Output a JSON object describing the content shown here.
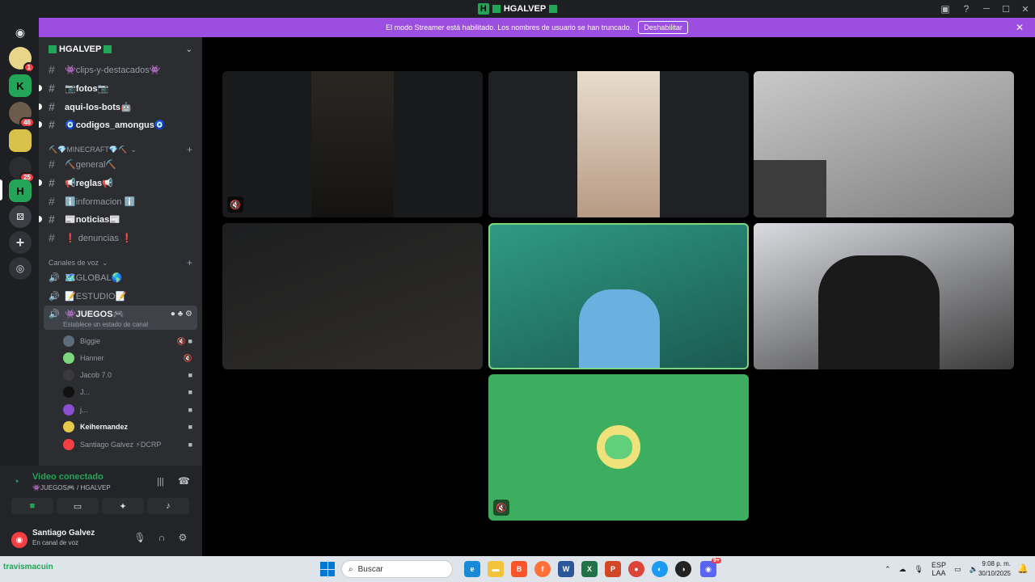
{
  "titlebar": {
    "title": "HGALVEP"
  },
  "banner": {
    "message": "El modo Streamer está habilitado. Los nombres de usuario se han truncado.",
    "button": "Deshabilitar"
  },
  "rail": {
    "badges": [
      "1",
      "46",
      "25"
    ]
  },
  "guild": {
    "name": "HGALVEP"
  },
  "channels": [
    {
      "name": "👾clips-y-destacados👾",
      "bold": false
    },
    {
      "name": "📷fotos📷",
      "bold": true
    },
    {
      "name": "aqui-los-bots🤖",
      "bold": true
    },
    {
      "name": "🧿codigos_amongus🧿",
      "bold": true
    }
  ],
  "category_minecraft": "⛏️💎MINECRAFT💎⛏️",
  "minecraft_channels": [
    {
      "name": "⛏️general⛏️",
      "bold": false
    },
    {
      "name": "📢reglas📢",
      "bold": true
    },
    {
      "name": "ℹ️informacion ℹ️",
      "bold": false
    },
    {
      "name": "📰noticias📰",
      "bold": true
    },
    {
      "name": "❗ denuncias ❗",
      "bold": false
    }
  ],
  "category_voice": "Canales de voz",
  "voice_channels": [
    {
      "name": "🗺️GLOBAL🌎"
    },
    {
      "name": "📝ESTUDIO📝"
    }
  ],
  "active_voice": {
    "name": "👾JUEGOS🎮",
    "status_hint": "Establece un estado de canal"
  },
  "voice_users": [
    {
      "name": "Biggie",
      "color": "#5d6b7a",
      "bold": false,
      "icons": "🔇 ■"
    },
    {
      "name": "Hanner",
      "color": "#7dd87d",
      "bold": false,
      "icons": "🔇"
    },
    {
      "name": "Jacob 7.0",
      "color": "#3a3a3a",
      "bold": false,
      "icons": "■"
    },
    {
      "name": "J...",
      "color": "#111111",
      "bold": false,
      "icons": "■"
    },
    {
      "name": "j...",
      "color": "#8a4fd0",
      "bold": false,
      "icons": "■"
    },
    {
      "name": "Keihernandez",
      "color": "#e6c84a",
      "bold": true,
      "icons": "■"
    },
    {
      "name": "Santiago Galvez ⚡DCRP",
      "color": "#f23f43",
      "bold": false,
      "icons": "■"
    }
  ],
  "voice_connected": {
    "title": "Video conectado",
    "subtitle": "👾JUEGOS🎮 / HGALVEP"
  },
  "user": {
    "name": "Santiago Galvez",
    "status": "En canal de voz"
  },
  "taskbar": {
    "user_label": "travismacuin",
    "search_placeholder": "Buscar",
    "lang_top": "ESP",
    "lang_bottom": "LAA",
    "time": "9:08 p. m.",
    "date": "30/10/2025",
    "discord_badge": "9+"
  },
  "colors": {
    "banner": "#9b4ee0",
    "speaking": "#7dd87d",
    "avatar_tile": "#3dae5f",
    "connected": "#23a559"
  }
}
